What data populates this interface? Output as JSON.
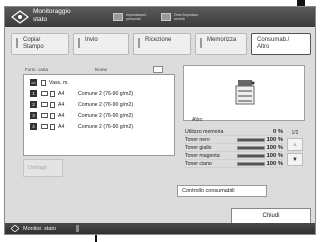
{
  "header": {
    "title": "Monitoraggio\nstato",
    "button1": "Impostazioni\npersonali",
    "button2": "Dest./Impostaz.\nrecenti"
  },
  "tabs": [
    {
      "label": "Copia/\nStampo"
    },
    {
      "label": "Invio"
    },
    {
      "label": "Ricezione"
    },
    {
      "label": "Memorizza"
    },
    {
      "label": "Consumab./\nAltro"
    }
  ],
  "paper_list": {
    "columns": [
      "Form. carta",
      "Nome"
    ],
    "header_row": "Vass. m.",
    "rows": [
      {
        "num": "1",
        "size": "A4",
        "type": "Comune 2 (76-90 g/m2)"
      },
      {
        "num": "2",
        "size": "A4",
        "type": "Comune 2 (76-90 g/m2)"
      },
      {
        "num": "3",
        "size": "A4",
        "type": "Comune 2 (76-90 g/m2)"
      },
      {
        "num": "4",
        "size": "A4",
        "type": "Comune 2 (76-90 g/m2)"
      }
    ],
    "details_button": "Dettagli"
  },
  "status": {
    "section_label": "Altro",
    "items": [
      {
        "label": "Utilizzo memoria",
        "value": "0 %",
        "fill": 0,
        "has_bar": false
      },
      {
        "label": "Toner nero",
        "value": "100 %",
        "fill": 1.0,
        "has_bar": true
      },
      {
        "label": "Toner giallo",
        "value": "100 %",
        "fill": 1.0,
        "has_bar": true
      },
      {
        "label": "Toner magenta",
        "value": "100 %",
        "fill": 1.0,
        "has_bar": true
      },
      {
        "label": "Toner ciano",
        "value": "100 %",
        "fill": 1.0,
        "has_bar": true
      }
    ],
    "page": "1/2"
  },
  "consumables_button": "Controllo consumabili",
  "close_button": "Chiudi",
  "footer": {
    "status_label": "Monitor. stato"
  }
}
